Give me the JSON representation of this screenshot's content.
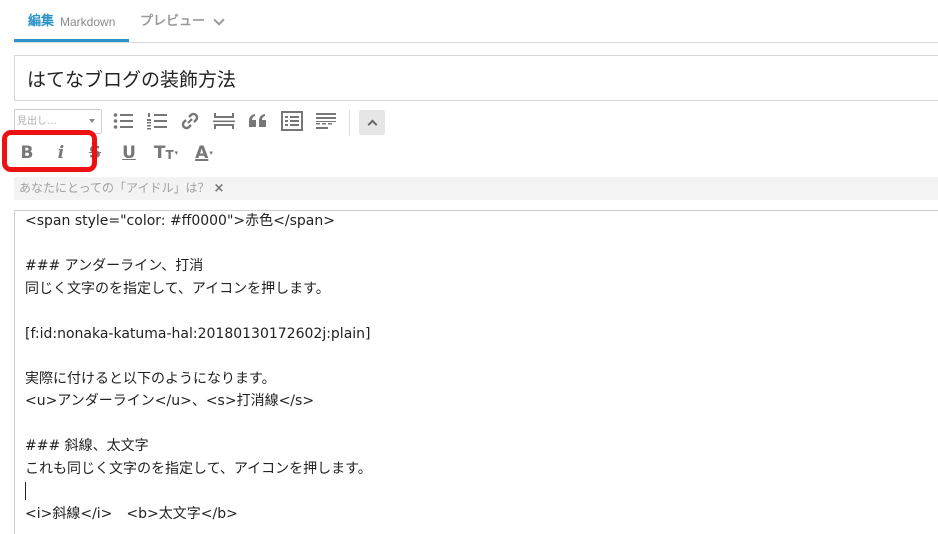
{
  "tabs": {
    "edit_label": "編集",
    "edit_mode": "Markdown",
    "preview_label": "プレビュー"
  },
  "title": "はてなブログの装飾方法",
  "toolbar": {
    "heading_select": "見出し",
    "icons_row1": [
      "unordered-list-icon",
      "ordered-list-icon",
      "link-icon",
      "horizontal-rule-icon",
      "quote-icon",
      "table-icon",
      "more-icon"
    ],
    "icons_row2": [
      "bold-icon",
      "italic-icon",
      "strikethrough-icon",
      "underline-icon",
      "font-size-icon",
      "font-color-icon"
    ],
    "bold": "B",
    "italic": "i",
    "strike": "S",
    "underline": "U",
    "font_size": "T",
    "font_color": "A"
  },
  "topic": {
    "text": "あなたにとっての「アイドル」は？",
    "close": "×"
  },
  "editor": {
    "lines": [
      "<span style=\"color: #ff0000\">赤色</span>",
      "",
      "### アンダーライン、打消",
      "同じく文字のを指定して、アイコンを押します。",
      "",
      "[f:id:nonaka-katuma-hal:20180130172602j:plain]",
      "",
      "実際に付けると以下のようになります。",
      "<u>アンダーライン</u>、<s>打消線</s>",
      "",
      "### 斜線、太文字",
      "これも同じく文字のを指定して、アイコンを押します。",
      "",
      "<i>斜線</i>　<b>太文字</b>"
    ]
  },
  "colors": {
    "accent": "#2e93c9",
    "highlight": "#ee1111"
  }
}
